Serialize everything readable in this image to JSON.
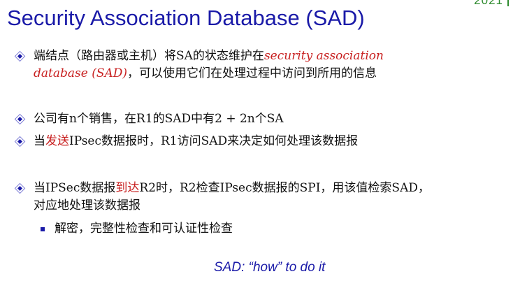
{
  "year_tag": "2021",
  "title": "Security Association Database (SAD)",
  "bullets": {
    "b1": {
      "text_a": "端结点（路由器或主机）将SA的状态维护在",
      "highlight_a": "security association",
      "highlight_b": "database (SAD)",
      "text_b": "，可以使用它们在处理过程中访问到所用的信息"
    },
    "b2": {
      "text": "公司有n个销售，在R1的SAD中有2 + 2n个SA"
    },
    "b3": {
      "text_a": "当",
      "highlight": "发送",
      "text_b": "IPsec数据报时，R1访问SAD来决定如何处理该数据报"
    },
    "b4": {
      "text_a": "当IPSec数据报",
      "highlight": "到达",
      "text_b": "R2时，R2检查IPsec数据报的SPI，用该值检索SAD，",
      "line2": "对应地处理该数据报"
    },
    "sub1": {
      "text": "解密，完整性检查和可认证性检查"
    }
  },
  "footer": "SAD: “how” to do it",
  "colors": {
    "title": "#1a1aa8",
    "highlight": "#c82020",
    "year": "#2e8b2e"
  }
}
